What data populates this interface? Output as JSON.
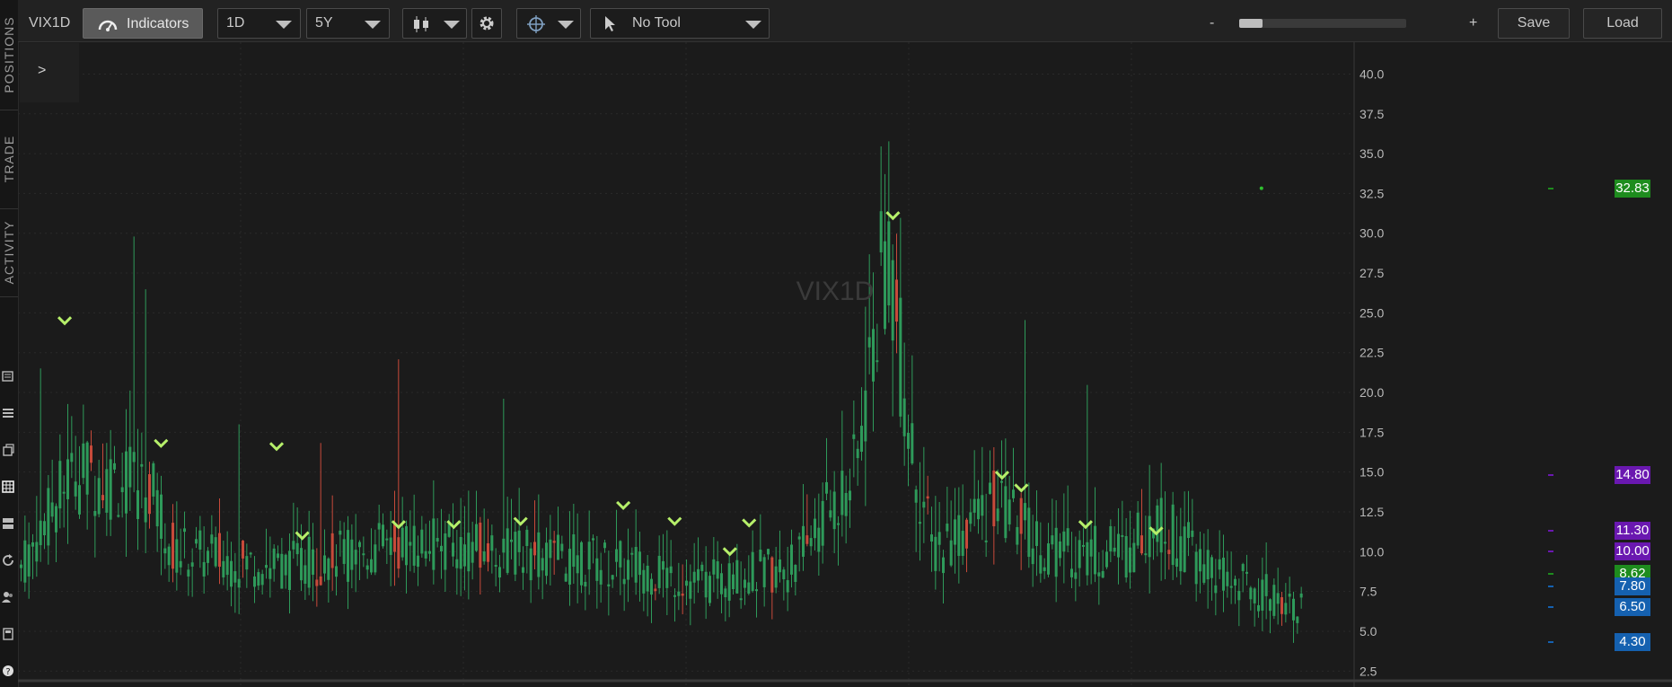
{
  "sidebar": {
    "tabs": [
      "POSITIONS",
      "TRADE",
      "ACTIVITY"
    ],
    "icons": [
      "news-icon",
      "list-icon",
      "copy-icon",
      "grid-icon",
      "layout-icon",
      "refresh-icon",
      "users-icon",
      "calculator-icon",
      "help-icon"
    ]
  },
  "toolbar": {
    "symbol": "VIX1D",
    "indicators_label": "Indicators",
    "interval_value": "1D",
    "range_value": "5Y",
    "tool_value": "No Tool",
    "zoom_minus": "-",
    "zoom_plus": "+",
    "save_label": "Save",
    "load_label": "Load"
  },
  "expand_label": ">",
  "watermark": "VIX1D",
  "colors": {
    "up": "#2e9a5a",
    "down": "#c74a3a",
    "marker": "#b6ef6a",
    "grid": "#2a2a2a",
    "axis_text": "#b9b9b9"
  },
  "badges": [
    {
      "label": "32.83",
      "value": 32.83,
      "bg": "#1e8c1e"
    },
    {
      "label": "14.80",
      "value": 14.8,
      "bg": "#6a18b0"
    },
    {
      "label": "11.30",
      "value": 11.3,
      "bg": "#6a18b0"
    },
    {
      "label": "10.00",
      "value": 10.0,
      "bg": "#6a18b0"
    },
    {
      "label": "8.62",
      "value": 8.62,
      "bg": "#1e8c1e"
    },
    {
      "label": "7.80",
      "value": 7.8,
      "bg": "#1561b0"
    },
    {
      "label": "6.50",
      "value": 6.5,
      "bg": "#1561b0"
    },
    {
      "label": "4.30",
      "value": 4.3,
      "bg": "#1561b0"
    }
  ],
  "chart_data": {
    "type": "bar",
    "y_ticks": [
      "2.5",
      "5.0",
      "7.5",
      "10.0",
      "12.5",
      "15.0",
      "17.5",
      "20.0",
      "22.5",
      "25.0",
      "27.5",
      "30.0",
      "32.5",
      "35.0",
      "37.5",
      "40.0"
    ],
    "ylim": [
      1.5,
      42
    ],
    "series": [
      {
        "key_points": [
          [
            0,
            9.0
          ],
          [
            0.04,
            15.0
          ],
          [
            0.1,
            14.0
          ],
          [
            0.12,
            10.0
          ],
          [
            0.2,
            9.0
          ],
          [
            0.3,
            10.5
          ],
          [
            0.38,
            10.0
          ],
          [
            0.48,
            9.0
          ],
          [
            0.53,
            8.0
          ],
          [
            0.6,
            9.0
          ],
          [
            0.65,
            15.0
          ],
          [
            0.675,
            30.0
          ],
          [
            0.69,
            18.0
          ],
          [
            0.71,
            10.0
          ],
          [
            0.76,
            13.0
          ],
          [
            0.8,
            10.0
          ],
          [
            0.86,
            10.0
          ],
          [
            0.885,
            12.0
          ],
          [
            0.93,
            8.5
          ],
          [
            1.0,
            6.5
          ]
        ]
      }
    ],
    "markers": [
      {
        "x": 0.035,
        "y": 24.5
      },
      {
        "x": 0.11,
        "y": 16.8
      },
      {
        "x": 0.2,
        "y": 16.6
      },
      {
        "x": 0.22,
        "y": 11.0
      },
      {
        "x": 0.295,
        "y": 11.7
      },
      {
        "x": 0.338,
        "y": 11.7
      },
      {
        "x": 0.39,
        "y": 11.9
      },
      {
        "x": 0.47,
        "y": 12.9
      },
      {
        "x": 0.51,
        "y": 11.9
      },
      {
        "x": 0.553,
        "y": 10.0
      },
      {
        "x": 0.568,
        "y": 11.8
      },
      {
        "x": 0.68,
        "y": 31.1
      },
      {
        "x": 0.765,
        "y": 14.8
      },
      {
        "x": 0.78,
        "y": 14.0
      },
      {
        "x": 0.83,
        "y": 11.7
      },
      {
        "x": 0.885,
        "y": 11.3
      }
    ],
    "last_point": {
      "x": 0.96,
      "y": 32.83
    }
  }
}
